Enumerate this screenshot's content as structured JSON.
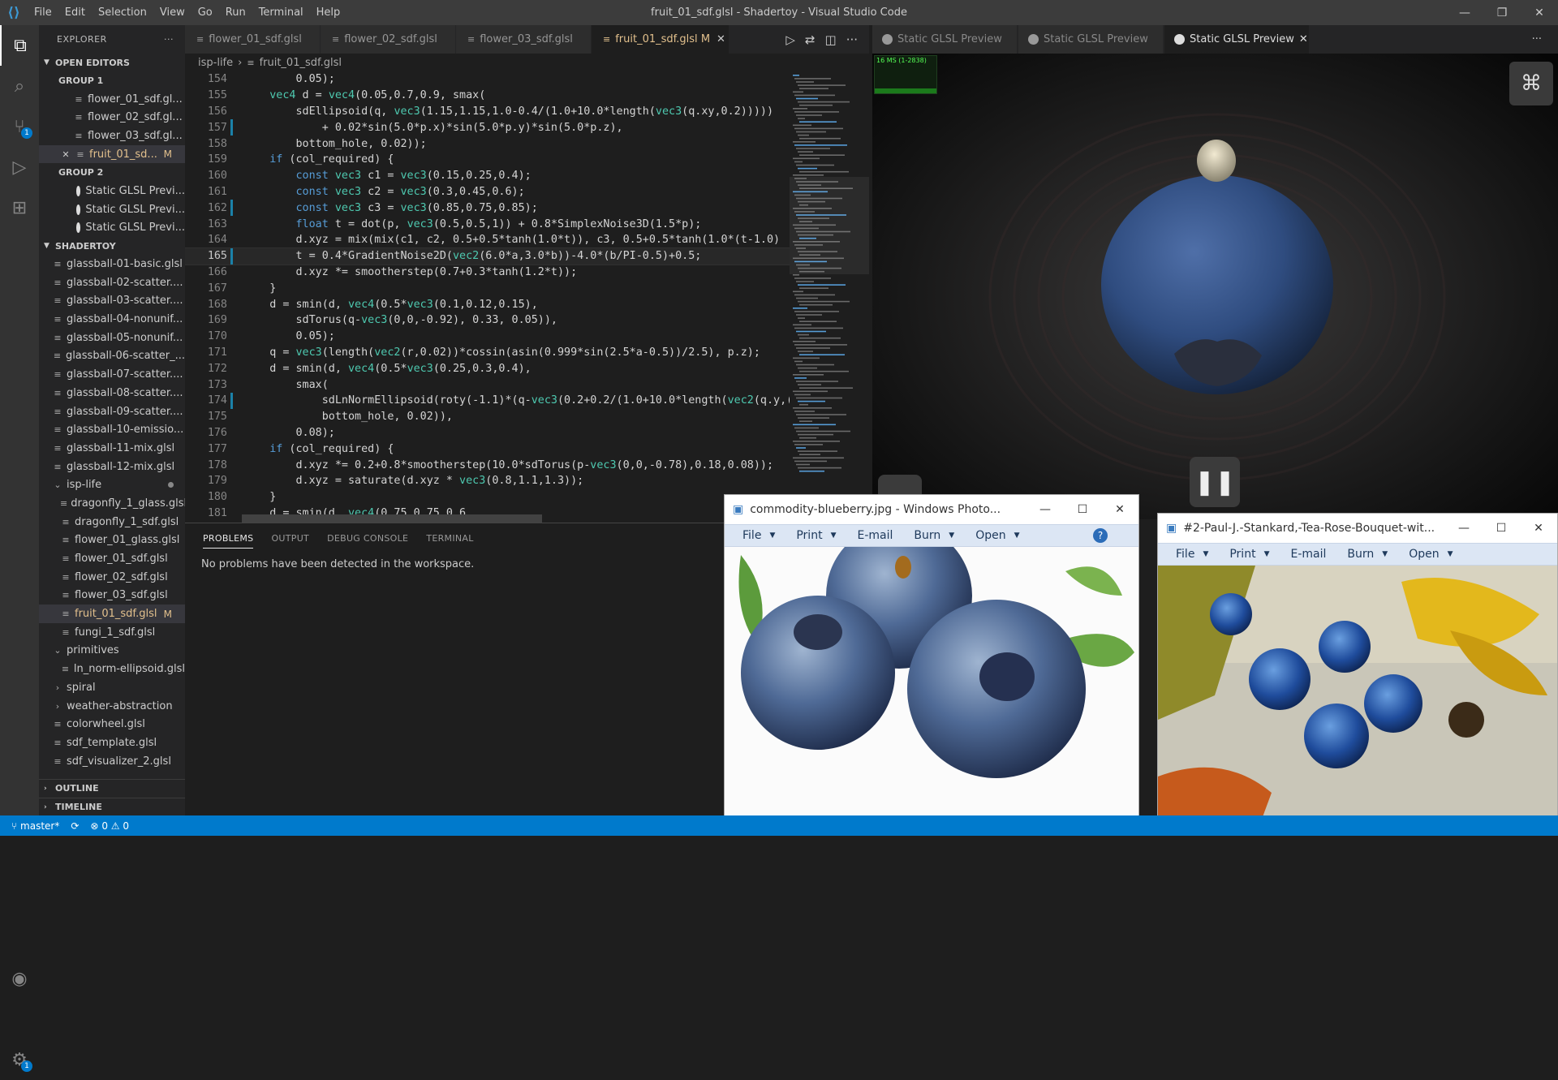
{
  "titlebar": {
    "title": "fruit_01_sdf.glsl - Shadertoy - Visual Studio Code",
    "menu": [
      "File",
      "Edit",
      "Selection",
      "View",
      "Go",
      "Run",
      "Terminal",
      "Help"
    ]
  },
  "explorer": {
    "header": "EXPLORER",
    "open_editors": "OPEN EDITORS",
    "group1": "GROUP 1",
    "group1_items": [
      "flower_01_sdf.gl...",
      "flower_02_sdf.gl...",
      "flower_03_sdf.gl..."
    ],
    "group1_active": "fruit_01_sd...",
    "group1_active_badge": "M",
    "group2": "GROUP 2",
    "group2_items": [
      "Static GLSL Previ...",
      "Static GLSL Previ...",
      "Static GLSL Previ..."
    ],
    "workspace": "SHADERTOY",
    "files": [
      "glassball-01-basic.glsl",
      "glassball-02-scatter....",
      "glassball-03-scatter....",
      "glassball-04-nonunif...",
      "glassball-05-nonunif...",
      "glassball-06-scatter_...",
      "glassball-07-scatter....",
      "glassball-08-scatter....",
      "glassball-09-scatter....",
      "glassball-10-emissio...",
      "glassball-11-mix.glsl",
      "glassball-12-mix.glsl"
    ],
    "isp_folder": "isp-life",
    "isp_files": [
      "dragonfly_1_glass.glsl",
      "dragonfly_1_sdf.glsl",
      "flower_01_glass.glsl",
      "flower_01_sdf.glsl",
      "flower_02_sdf.glsl",
      "flower_03_sdf.glsl"
    ],
    "isp_selected": "fruit_01_sdf.glsl",
    "isp_selected_badge": "M",
    "isp_after": "fungi_1_sdf.glsl",
    "primitives": "primitives",
    "prim_file": "ln_norm-ellipsoid.glsl",
    "spiral": "spiral",
    "weather": "weather-abstraction",
    "rest_files": [
      "colorwheel.glsl",
      "sdf_template.glsl",
      "sdf_visualizer_2.glsl"
    ],
    "outline": "OUTLINE",
    "timeline": "TIMELINE"
  },
  "editor_tabs": [
    {
      "label": "flower_01_sdf.glsl"
    },
    {
      "label": "flower_02_sdf.glsl"
    },
    {
      "label": "flower_03_sdf.glsl"
    },
    {
      "label": "fruit_01_sdf.glsl",
      "badge": "M"
    }
  ],
  "breadcrumb": {
    "folder": "isp-life",
    "file": "fruit_01_sdf.glsl"
  },
  "code_lines": [
    {
      "n": "154",
      "t": "        0.05);"
    },
    {
      "n": "155",
      "t": "    vec4 d = vec4(0.05,0.7,0.9, smax("
    },
    {
      "n": "156",
      "t": "        sdEllipsoid(q, vec3(1.15,1.15,1.0-0.4/(1.0+10.0*length(vec3(q.xy,0.2)))))"
    },
    {
      "n": "157",
      "t": "            + 0.02*sin(5.0*p.x)*sin(5.0*p.y)*sin(5.0*p.z),"
    },
    {
      "n": "158",
      "t": "        bottom_hole, 0.02));"
    },
    {
      "n": "159",
      "t": "    if (col_required) {"
    },
    {
      "n": "160",
      "t": "        const vec3 c1 = vec3(0.15,0.25,0.4);"
    },
    {
      "n": "161",
      "t": "        const vec3 c2 = vec3(0.3,0.45,0.6);"
    },
    {
      "n": "162",
      "t": "        const vec3 c3 = vec3(0.85,0.75,0.85);"
    },
    {
      "n": "163",
      "t": "        float t = dot(p, vec3(0.5,0.5,1)) + 0.8*SimplexNoise3D(1.5*p);"
    },
    {
      "n": "164",
      "t": "        d.xyz = mix(mix(c1, c2, 0.5+0.5*tanh(1.0*t)), c3, 0.5+0.5*tanh(1.0*(t-1.0)"
    },
    {
      "n": "165",
      "t": "        t = 0.4*GradientNoise2D(vec2(6.0*a,3.0*b))-4.0*(b/PI-0.5)+0.5;"
    },
    {
      "n": "166",
      "t": "        d.xyz *= smootherstep(0.7+0.3*tanh(1.2*t));"
    },
    {
      "n": "167",
      "t": "    }"
    },
    {
      "n": "168",
      "t": "    d = smin(d, vec4(0.5*vec3(0.1,0.12,0.15),"
    },
    {
      "n": "169",
      "t": "        sdTorus(q-vec3(0,0,-0.92), 0.33, 0.05)),"
    },
    {
      "n": "170",
      "t": "        0.05);"
    },
    {
      "n": "171",
      "t": "    q = vec3(length(vec2(r,0.02))*cossin(asin(0.999*sin(2.5*a-0.5))/2.5), p.z);"
    },
    {
      "n": "172",
      "t": "    d = smin(d, vec4(0.5*vec3(0.25,0.3,0.4),"
    },
    {
      "n": "173",
      "t": "        smax("
    },
    {
      "n": "174",
      "t": "            sdLnNormEllipsoid(roty(-1.1)*(q-vec3(0.2+0.2/(1.0+10.0*length(vec2(q.y,("
    },
    {
      "n": "175",
      "t": "            bottom_hole, 0.02)),"
    },
    {
      "n": "176",
      "t": "        0.08);"
    },
    {
      "n": "177",
      "t": "    if (col_required) {"
    },
    {
      "n": "178",
      "t": "        d.xyz *= 0.2+0.8*smootherstep(10.0*sdTorus(p-vec3(0,0,-0.78),0.18,0.08));"
    },
    {
      "n": "179",
      "t": "        d.xyz = saturate(d.xyz * vec3(0.8,1.1,1.3));"
    },
    {
      "n": "180",
      "t": "    }"
    },
    {
      "n": "181",
      "t": "    d = smin(d, vec4(0.75,0.75,0.6,"
    }
  ],
  "panel": {
    "tabs": [
      "PROBLEMS",
      "OUTPUT",
      "DEBUG CONSOLE",
      "TERMINAL"
    ],
    "message": "No problems have been detected in the workspace."
  },
  "preview_tabs": [
    "Static GLSL Preview",
    "Static GLSL Preview",
    "Static GLSL Preview"
  ],
  "perf_label": "16 MS (1-2838)",
  "photo1": {
    "title": "commodity-blueberry.jpg - Windows Photo...",
    "toolbar": [
      "File",
      "Print",
      "E-mail",
      "Burn",
      "Open"
    ]
  },
  "photo2": {
    "title": "#2-Paul-J.-Stankard,-Tea-Rose-Bouquet-wit...",
    "toolbar": [
      "File",
      "Print",
      "E-mail",
      "Burn",
      "Open"
    ]
  },
  "status": {
    "branch": "master*",
    "errors": "0",
    "warnings": "0"
  }
}
